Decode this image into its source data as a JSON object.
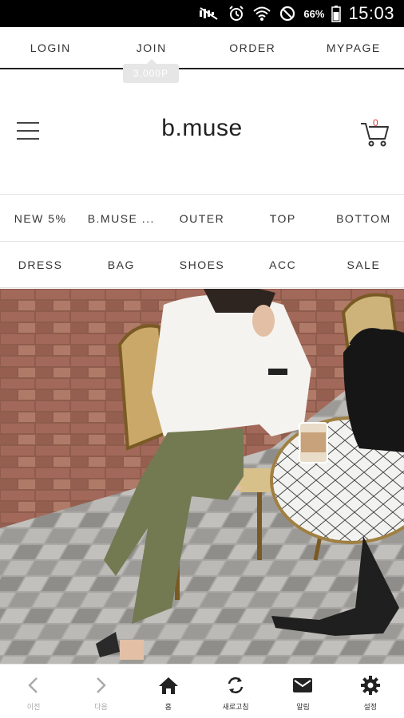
{
  "status_bar": {
    "battery_percent": "66%",
    "time": "15:03",
    "icons": [
      "mute-icon",
      "alarm-icon",
      "wifi-icon",
      "do-not-disturb-icon",
      "battery-icon"
    ]
  },
  "top_links": [
    {
      "label": "LOGIN"
    },
    {
      "label": "JOIN"
    },
    {
      "label": "ORDER"
    },
    {
      "label": "MYPAGE"
    }
  ],
  "join_badge": "3,000P",
  "header": {
    "logo": "b.muse",
    "cart_count": "0",
    "icons": [
      "menu-icon",
      "cart-icon"
    ]
  },
  "categories_row1": [
    {
      "label": "NEW 5%"
    },
    {
      "label": "B.MUSE ..."
    },
    {
      "label": "OUTER"
    },
    {
      "label": "TOP"
    },
    {
      "label": "BOTTOM"
    }
  ],
  "categories_row2": [
    {
      "label": "DRESS"
    },
    {
      "label": "BAG"
    },
    {
      "label": "SHOES"
    },
    {
      "label": "ACC"
    },
    {
      "label": "SALE"
    }
  ],
  "bottom_nav": [
    {
      "label": "이전",
      "icon": "chevron-left-icon"
    },
    {
      "label": "다음",
      "icon": "chevron-right-icon"
    },
    {
      "label": "홈",
      "icon": "home-icon"
    },
    {
      "label": "새로고침",
      "icon": "refresh-icon"
    },
    {
      "label": "알림",
      "icon": "mail-icon"
    },
    {
      "label": "설정",
      "icon": "gear-icon"
    }
  ],
  "colors": {
    "accent_cart_count": "#e23a3a",
    "status_bar": "#000000",
    "text": "#333333"
  }
}
